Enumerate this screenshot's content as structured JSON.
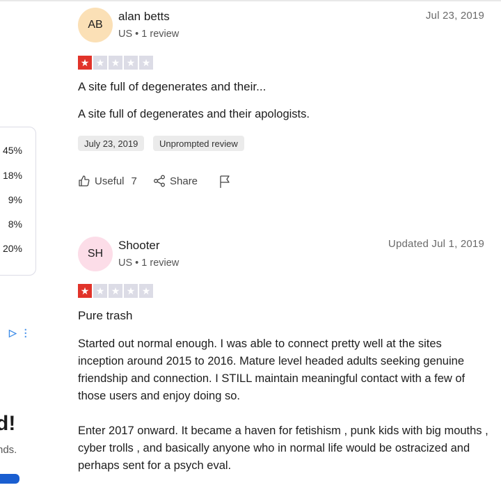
{
  "sidebar": {
    "distribution": [
      "45%",
      "18%",
      "9%",
      "8%",
      "20%"
    ],
    "ad": {
      "excl": "d!",
      "text": "nds."
    }
  },
  "reviews": [
    {
      "initials": "AB",
      "avatar_color": "#fbe0b6",
      "name": "alan betts",
      "meta": "US • 1 review",
      "date": "Jul 23, 2019",
      "rating": 1,
      "title": "A site full of degenerates and their...",
      "paragraphs": [
        "A site full of degenerates and their apologists."
      ],
      "tags": [
        "July 23, 2019",
        "Unprompted review"
      ],
      "useful_label": "Useful",
      "useful_count": "7",
      "share_label": "Share"
    },
    {
      "initials": "SH",
      "avatar_color": "#fcdde8",
      "name": "Shooter",
      "meta": "US • 1 review",
      "date": "Updated Jul 1, 2019",
      "rating": 1,
      "title": "Pure trash",
      "paragraphs": [
        "Started out normal enough. I was able to connect pretty well at the sites inception around 2015 to 2016. Mature level headed adults seeking genuine friendship and connection. I STILL maintain meaningful contact with a few of those users and enjoy doing so.",
        "Enter 2017 onward. It became a haven for fetishism , punk kids with big mouths , cyber trolls , and basically anyone who in normal life would be ostracized and perhaps sent for a psych eval."
      ]
    }
  ],
  "colors": {
    "star_on": "#e1332a",
    "star_off": "#dcdce6",
    "ad_accent": "#3d8ce8"
  }
}
